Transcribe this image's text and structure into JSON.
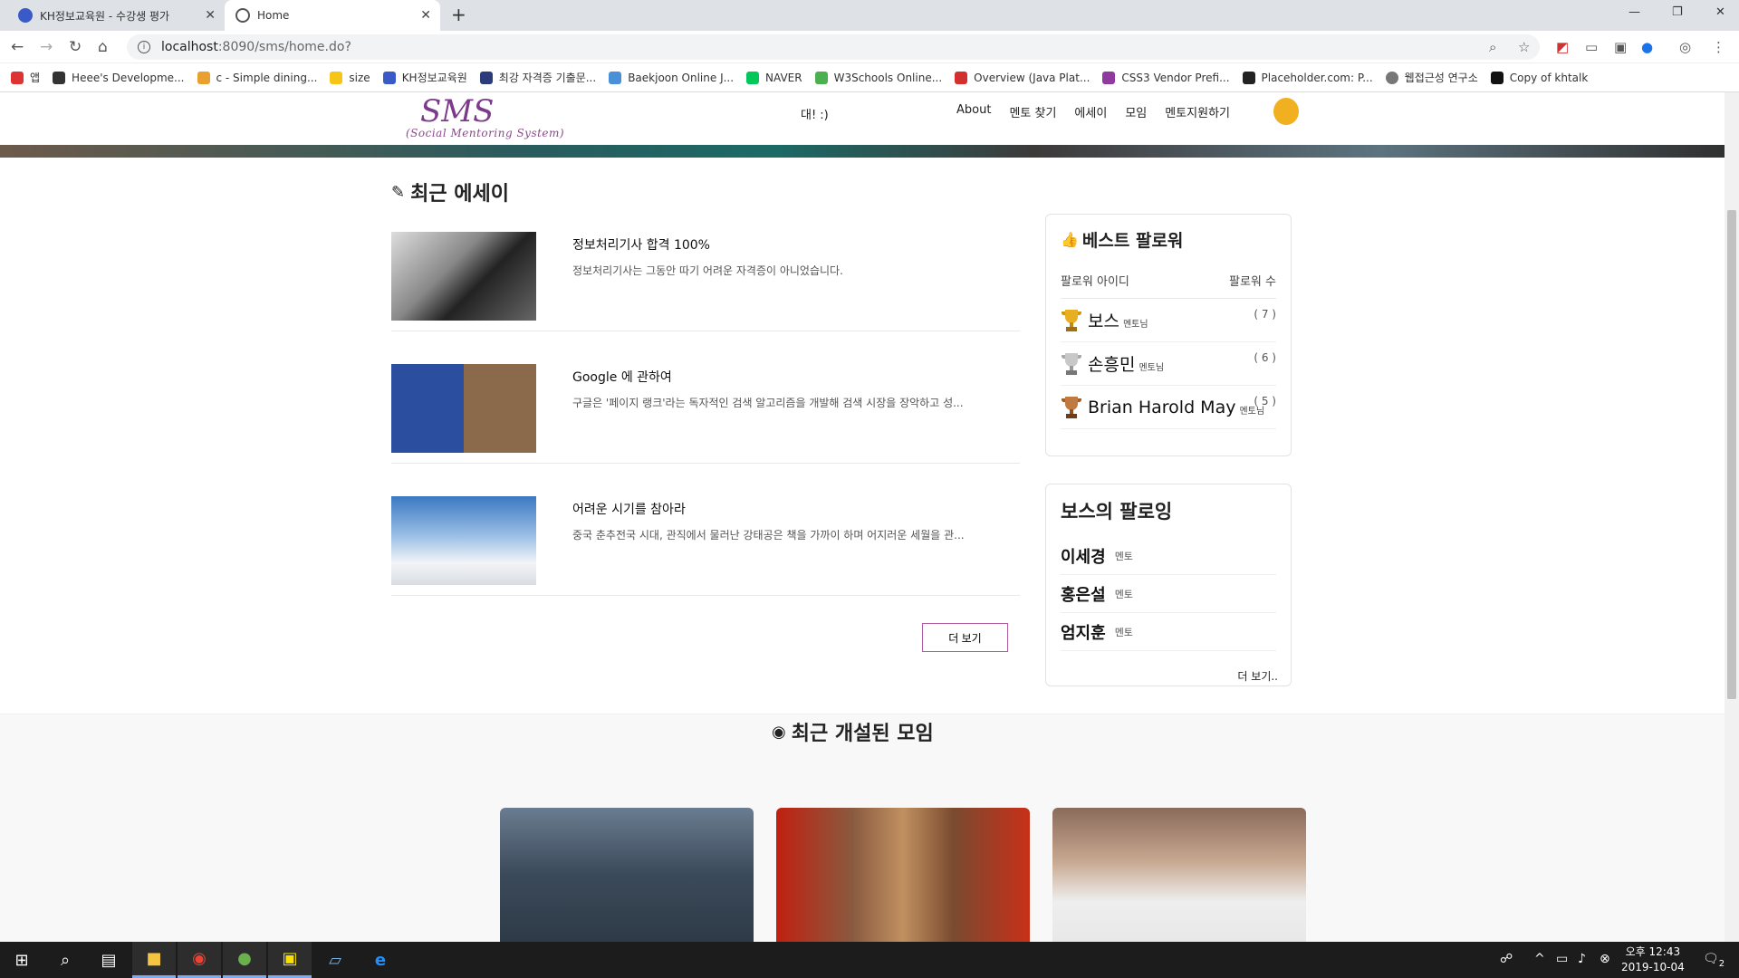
{
  "browser": {
    "tabs": [
      {
        "title": "KH정보교육원 - 수강생 평가"
      },
      {
        "title": "Home"
      }
    ],
    "new_tab": "+",
    "url_host": "localhost",
    "url_path": ":8090/sms/home.do?",
    "bookmarks": [
      "앱",
      "Heee's Developme...",
      "c - Simple dining...",
      "size",
      "KH정보교육원",
      "최강 자격증 기출문...",
      "Baekjoon Online J...",
      "NAVER",
      "W3Schools Online...",
      "Overview (Java Plat...",
      "CSS3 Vendor Prefi...",
      "Placeholder.com: P...",
      "웹접근성 연구소",
      "Copy of khtalk"
    ]
  },
  "nav": {
    "logo_title": "SMS",
    "logo_subtitle": "(Social Mentoring System)",
    "greeting": "대! :)",
    "menu": [
      "About",
      "멘토 찾기",
      "에세이",
      "모임",
      "멘토지원하기"
    ]
  },
  "essays": {
    "section_title": "최근 에세이",
    "items": [
      {
        "title": "정보처리기사 합격 100%",
        "desc": "정보처리기사는 그동안 따기 어려운 자격증이 아니었습니다."
      },
      {
        "title": "Google 에 관하여",
        "desc": "구글은 '페이지 랭크'라는 독자적인 검색 알고리즘을 개발해 검색 시장을 장악하고 성..."
      },
      {
        "title": "어려운 시기를 참아라",
        "desc": "중국 춘추전국 시대, 관직에서 물러난 강태공은 책을 가까이 하며 어지러운 세월을 관..."
      }
    ],
    "more_button": "더 보기"
  },
  "best_followers": {
    "title": "베스트 팔로워",
    "col_id": "팔로워 아이디",
    "col_count": "팔로워 수",
    "rows": [
      {
        "name": "보스",
        "tag": "멘토님",
        "count": "( 7 )"
      },
      {
        "name": "손흥민",
        "tag": "멘토님",
        "count": "( 6 )"
      },
      {
        "name": "Brian Harold May",
        "tag": "멘토님",
        "count": "( 5 )"
      }
    ]
  },
  "following": {
    "title": "보스의 팔로잉",
    "rows": [
      {
        "name": "이세경",
        "tag": "멘토"
      },
      {
        "name": "홍은설",
        "tag": "멘토"
      },
      {
        "name": "엄지훈",
        "tag": "멘토"
      }
    ],
    "more": "더 보기.."
  },
  "meetings": {
    "section_title": "최근 개설된 모임"
  },
  "taskbar": {
    "time": "오후 12:43",
    "date": "2019-10-04",
    "notif_count": "2"
  },
  "colors": {
    "accent": "#b05aa0",
    "logo": "#7a3b8a"
  }
}
